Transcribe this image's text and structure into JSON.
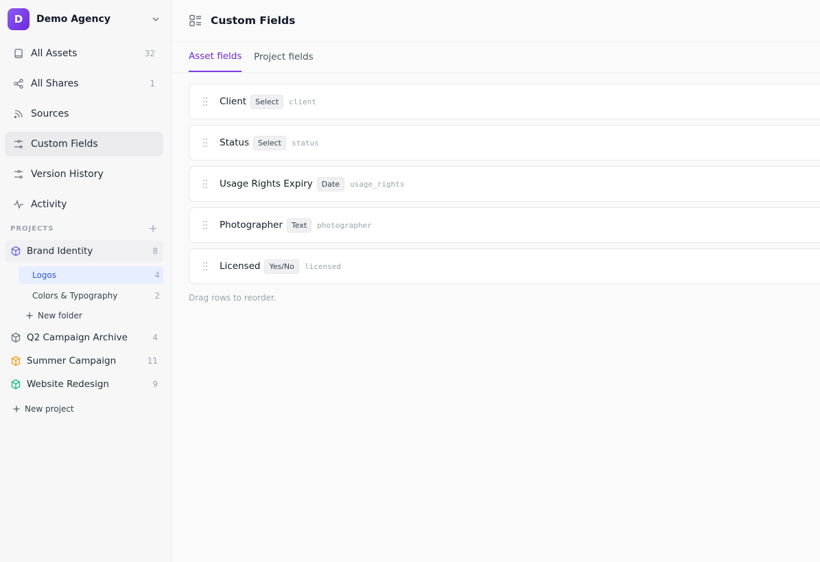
{
  "workspace": {
    "initial": "D",
    "name": "Demo Agency"
  },
  "nav": [
    {
      "label": "All Assets",
      "count": "32",
      "icon": "book-icon"
    },
    {
      "label": "All Shares",
      "count": "1",
      "icon": "share-icon"
    },
    {
      "label": "Sources",
      "count": "",
      "icon": "rss-icon"
    },
    {
      "label": "Custom Fields",
      "count": "",
      "icon": "sliders-icon"
    },
    {
      "label": "Version History",
      "count": "",
      "icon": "history-icon"
    },
    {
      "label": "Activity",
      "count": "",
      "icon": "activity-icon"
    }
  ],
  "projects_section": {
    "label": "PROJECTS"
  },
  "projects": [
    {
      "label": "Brand Identity",
      "count": "8",
      "color": "#6366f1"
    },
    {
      "label": "Q2 Campaign Archive",
      "count": "4",
      "color": "#6b7280"
    },
    {
      "label": "Summer Campaign",
      "count": "11",
      "color": "#f59e0b"
    },
    {
      "label": "Website Redesign",
      "count": "9",
      "color": "#10b981"
    }
  ],
  "folders": [
    {
      "label": "Logos",
      "count": "4"
    },
    {
      "label": "Colors & Typography",
      "count": "2"
    }
  ],
  "new_folder_label": "New folder",
  "new_project_label": "New project",
  "page": {
    "title": "Custom Fields"
  },
  "tabs": [
    {
      "label": "Asset fields"
    },
    {
      "label": "Project fields"
    }
  ],
  "fields": [
    {
      "name": "Client",
      "type": "Select",
      "key": "client"
    },
    {
      "name": "Status",
      "type": "Select",
      "key": "status"
    },
    {
      "name": "Usage Rights Expiry",
      "type": "Date",
      "key": "usage_rights"
    },
    {
      "name": "Photographer",
      "type": "Text",
      "key": "photographer"
    },
    {
      "name": "Licensed",
      "type": "Yes/No",
      "key": "licensed"
    }
  ],
  "hint": "Drag rows to reorder.",
  "colors": {
    "accent": "#7c3aed",
    "active_folder": "#2f56d6"
  }
}
